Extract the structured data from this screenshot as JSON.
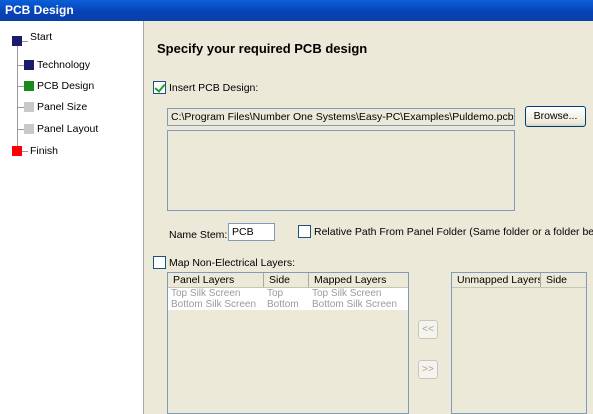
{
  "window": {
    "title": "PCB Design"
  },
  "nav": {
    "items": [
      {
        "label": "Start",
        "color": "#1a1b6b"
      },
      {
        "label": "Technology",
        "color": "#1a1b6b"
      },
      {
        "label": "PCB Design",
        "color": "#1a8a1a"
      },
      {
        "label": "Panel Size",
        "color": "#c8c8c8"
      },
      {
        "label": "Panel Layout",
        "color": "#c8c8c8"
      },
      {
        "label": "Finish",
        "color": "#ff0000"
      }
    ]
  },
  "main": {
    "heading": "Specify your required PCB design",
    "insert_checkbox": {
      "label": "Insert PCB Design:",
      "checked": true
    },
    "path_value": "C:\\Program Files\\Number One Systems\\Easy-PC\\Examples\\Puldemo.pcb",
    "browse_label": "Browse...",
    "name_stem": {
      "label": "Name Stem:",
      "value": "PCB"
    },
    "relative_path_checkbox": {
      "label": "Relative Path From Panel Folder (Same folder or a folder below it)",
      "checked": false
    },
    "map_checkbox": {
      "label": "Map Non-Electrical Layers:",
      "checked": false
    },
    "mapping_table": {
      "columns": [
        "Panel Layers",
        "Side",
        "Mapped Layers"
      ],
      "rows": [
        [
          "Top Silk Screen",
          "Top",
          "Top Silk Screen"
        ],
        [
          "Bottom Silk Screen",
          "Bottom",
          "Bottom Silk Screen"
        ]
      ]
    },
    "move_left_label": "<<",
    "move_right_label": ">>",
    "unmapped_table": {
      "columns": [
        "Unmapped Layers",
        "Side"
      ]
    }
  }
}
